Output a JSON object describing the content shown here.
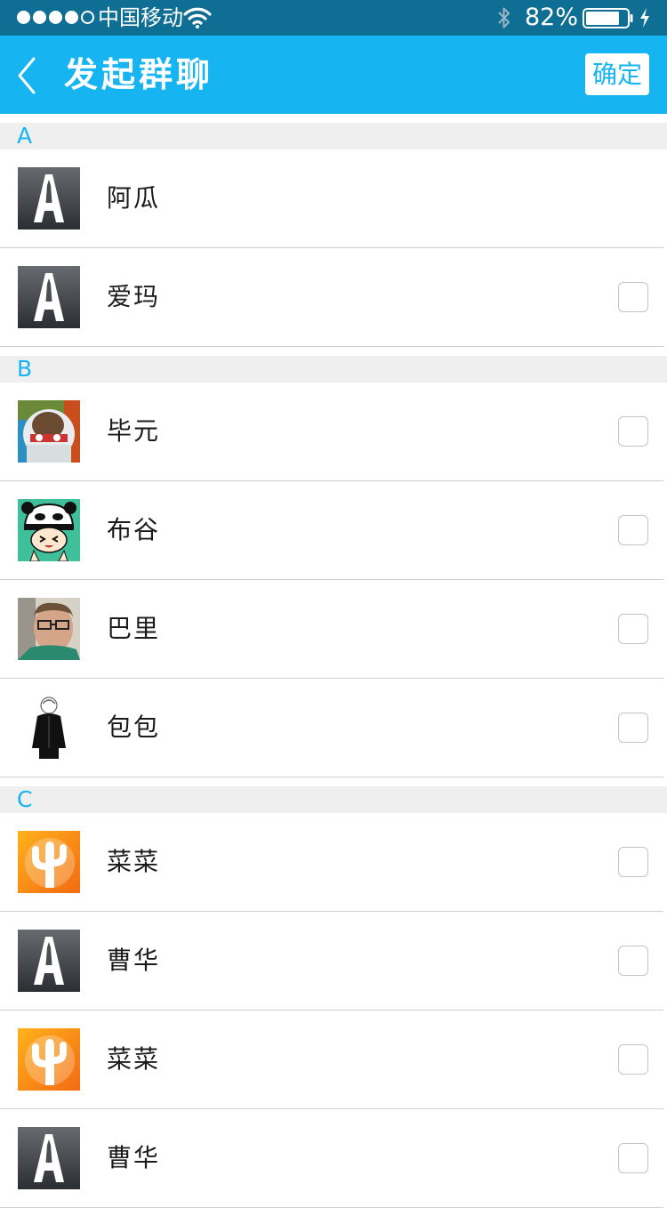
{
  "status_bar": {
    "signal_dots": [
      "on",
      "on",
      "on",
      "on",
      "off"
    ],
    "carrier": "中国移动",
    "wifi_icon": "wifi-icon",
    "bluetooth_icon": "bluetooth-icon",
    "battery_percent": "82%",
    "battery_level": 0.82,
    "charging_icon": "lightning-icon"
  },
  "nav": {
    "back_icon": "chevron-left-icon",
    "title": "发起群聊",
    "confirm_label": "确定"
  },
  "colors": {
    "status_bar_bg": "#0f6e93",
    "nav_bg": "#16b4f1",
    "section_letter": "#16b4f1",
    "section_bg": "#efefef"
  },
  "sections": [
    {
      "letter": "A",
      "contacts": [
        {
          "name": "阿瓜",
          "avatar": "a-logo",
          "checkbox": false
        },
        {
          "name": "爱玛",
          "avatar": "a-logo",
          "checkbox": true
        }
      ]
    },
    {
      "letter": "B",
      "contacts": [
        {
          "name": "毕元",
          "avatar": "astronaut-photo",
          "checkbox": true
        },
        {
          "name": "布谷",
          "avatar": "panda-hat-cartoon",
          "checkbox": true
        },
        {
          "name": "巴里",
          "avatar": "glasses-man-photo",
          "checkbox": true
        },
        {
          "name": "包包",
          "avatar": "black-coat-sketch",
          "checkbox": true
        }
      ]
    },
    {
      "letter": "C",
      "contacts": [
        {
          "name": "菜菜",
          "avatar": "orange-cactus-logo",
          "checkbox": true
        },
        {
          "name": "曹华",
          "avatar": "a-logo",
          "checkbox": true
        },
        {
          "name": "菜菜",
          "avatar": "orange-cactus-logo",
          "checkbox": true
        },
        {
          "name": "曹华",
          "avatar": "a-logo",
          "checkbox": true
        }
      ]
    }
  ]
}
